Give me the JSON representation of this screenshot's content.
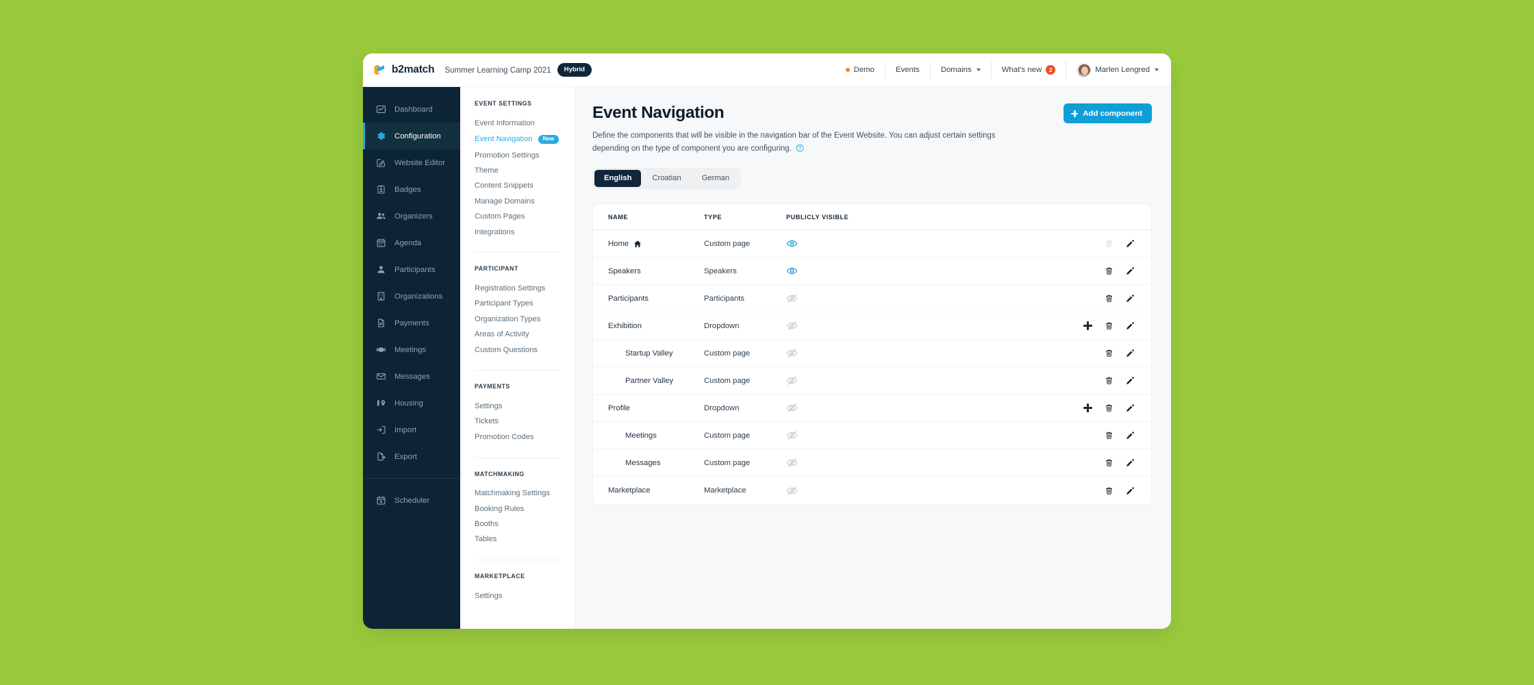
{
  "theme": {
    "page_background": "#9aca3c",
    "sidebar_background": "#0c2434",
    "accent_blue": "#29abe2",
    "button_blue": "#0f9fd6",
    "dark_navy": "#10263a",
    "orange_dot": "#f58220",
    "badge_red": "#f04e23"
  },
  "topbar": {
    "brand_name": "b2match",
    "event_name": "Summer Learning Camp 2021",
    "event_mode_badge": "Hybrid",
    "nav": [
      {
        "label": "Demo",
        "icon": "orange-dot",
        "has_chevron": false,
        "badge": null
      },
      {
        "label": "Events",
        "icon": null,
        "has_chevron": false,
        "badge": null
      },
      {
        "label": "Domains",
        "icon": null,
        "has_chevron": true,
        "badge": null
      },
      {
        "label": "What's new",
        "icon": null,
        "has_chevron": false,
        "badge": "2"
      }
    ],
    "user": {
      "name": "Marlen Lengred",
      "has_chevron": true,
      "avatar": "user-avatar"
    }
  },
  "sidebar": {
    "items": [
      {
        "label": "Dashboard",
        "icon": "chart-line-icon",
        "active": false
      },
      {
        "label": "Configuration",
        "icon": "gear-icon",
        "active": true
      },
      {
        "label": "Website Editor",
        "icon": "pencil-square-icon",
        "active": false
      },
      {
        "label": "Badges",
        "icon": "badge-id-icon",
        "active": false
      },
      {
        "label": "Organizers",
        "icon": "users-icon",
        "active": false
      },
      {
        "label": "Agenda",
        "icon": "calendar-icon",
        "active": false
      },
      {
        "label": "Participants",
        "icon": "user-icon",
        "active": false
      },
      {
        "label": "Organizations",
        "icon": "building-icon",
        "active": false
      },
      {
        "label": "Payments",
        "icon": "document-icon",
        "active": false
      },
      {
        "label": "Meetings",
        "icon": "handshake-icon",
        "active": false
      },
      {
        "label": "Messages",
        "icon": "envelope-icon",
        "active": false
      },
      {
        "label": "Housing",
        "icon": "map-pin-icon",
        "active": false
      },
      {
        "label": "Import",
        "icon": "import-icon",
        "active": false
      },
      {
        "label": "Export",
        "icon": "export-icon",
        "active": false
      }
    ],
    "footer_items": [
      {
        "label": "Scheduler",
        "icon": "calendar-plus-icon",
        "active": false
      }
    ]
  },
  "subnav": {
    "sections": [
      {
        "heading": "EVENT SETTINGS",
        "links": [
          {
            "label": "Event Information",
            "active": false,
            "badge": null
          },
          {
            "label": "Event Navigation",
            "active": true,
            "badge": "New"
          },
          {
            "label": "Promotion Settings",
            "active": false,
            "badge": null
          },
          {
            "label": "Theme",
            "active": false,
            "badge": null
          },
          {
            "label": "Content Snippets",
            "active": false,
            "badge": null
          },
          {
            "label": "Manage Domains",
            "active": false,
            "badge": null
          },
          {
            "label": "Custom Pages",
            "active": false,
            "badge": null
          },
          {
            "label": "Integrations",
            "active": false,
            "badge": null
          }
        ]
      },
      {
        "heading": "PARTICIPANT",
        "links": [
          {
            "label": "Registration Settings",
            "active": false,
            "badge": null
          },
          {
            "label": "Participant Types",
            "active": false,
            "badge": null
          },
          {
            "label": "Organization Types",
            "active": false,
            "badge": null
          },
          {
            "label": "Areas of Activity",
            "active": false,
            "badge": null
          },
          {
            "label": "Custom Questions",
            "active": false,
            "badge": null
          }
        ]
      },
      {
        "heading": "PAYMENTS",
        "links": [
          {
            "label": "Settings",
            "active": false,
            "badge": null
          },
          {
            "label": "Tickets",
            "active": false,
            "badge": null
          },
          {
            "label": "Promotion Codes",
            "active": false,
            "badge": null
          }
        ]
      },
      {
        "heading": "MATCHMAKING",
        "links": [
          {
            "label": "Matchmaking Settings",
            "active": false,
            "badge": null
          },
          {
            "label": "Booking Rules",
            "active": false,
            "badge": null
          },
          {
            "label": "Booths",
            "active": false,
            "badge": null
          },
          {
            "label": "Tables",
            "active": false,
            "badge": null
          }
        ]
      },
      {
        "heading": "MARKETPLACE",
        "links": [
          {
            "label": "Settings",
            "active": false,
            "badge": null
          }
        ]
      }
    ]
  },
  "main": {
    "title": "Event Navigation",
    "description": "Define the components that will be visible in the navigation bar of the Event Website. You can adjust certain settings depending on the type of component you are configuring.",
    "help_icon": "question-circle-icon",
    "add_button_label": "Add component",
    "add_button_icon": "plus-icon",
    "language_tabs": [
      {
        "label": "English",
        "active": true
      },
      {
        "label": "Croatian",
        "active": false
      },
      {
        "label": "German",
        "active": false
      }
    ],
    "table": {
      "columns": [
        "NAME",
        "TYPE",
        "PUBLICLY VISIBLE"
      ],
      "rows": [
        {
          "name": "Home",
          "type": "Custom  page",
          "visible": true,
          "name_icon": "home-icon",
          "indent": false,
          "has_add": false,
          "delete_disabled": true
        },
        {
          "name": "Speakers",
          "type": "Speakers",
          "visible": true,
          "name_icon": null,
          "indent": false,
          "has_add": false,
          "delete_disabled": false
        },
        {
          "name": "Participants",
          "type": "Participants",
          "visible": false,
          "name_icon": null,
          "indent": false,
          "has_add": false,
          "delete_disabled": false
        },
        {
          "name": "Exhibition",
          "type": "Dropdown",
          "visible": false,
          "name_icon": null,
          "indent": false,
          "has_add": true,
          "delete_disabled": false
        },
        {
          "name": "Startup Valley",
          "type": "Custom page",
          "visible": false,
          "name_icon": null,
          "indent": true,
          "has_add": false,
          "delete_disabled": false
        },
        {
          "name": "Partner Valley",
          "type": "Custom page",
          "visible": false,
          "name_icon": null,
          "indent": true,
          "has_add": false,
          "delete_disabled": false
        },
        {
          "name": "Profile",
          "type": "Dropdown",
          "visible": false,
          "name_icon": null,
          "indent": false,
          "has_add": true,
          "delete_disabled": false
        },
        {
          "name": "Meetings",
          "type": "Custom page",
          "visible": false,
          "name_icon": null,
          "indent": true,
          "has_add": false,
          "delete_disabled": false
        },
        {
          "name": "Messages",
          "type": "Custom page",
          "visible": false,
          "name_icon": null,
          "indent": true,
          "has_add": false,
          "delete_disabled": false
        },
        {
          "name": "Marketplace",
          "type": "Marketplace",
          "visible": false,
          "name_icon": null,
          "indent": false,
          "has_add": false,
          "delete_disabled": false
        }
      ],
      "icons": {
        "visible": "eye-icon",
        "hidden": "eye-slash-icon",
        "delete": "trash-icon",
        "edit": "pencil-icon",
        "add_child": "plus-icon"
      }
    }
  }
}
